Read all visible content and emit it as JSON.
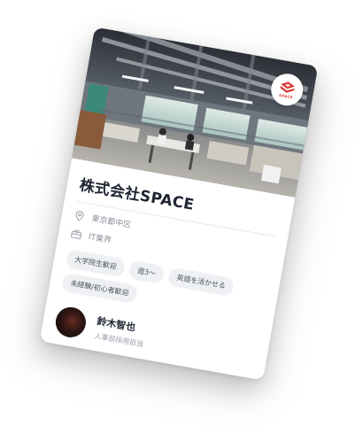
{
  "card": {
    "logo_text": "SPACE",
    "company_name": "株式会社SPACE",
    "location": "東京都中区",
    "industry": "IT業界",
    "tags": [
      "大学院生歓迎",
      "週3〜",
      "英語を活かせる",
      "未経験/初心者歓迎"
    ],
    "person": {
      "name": "鈴木智也",
      "title": "人事部採用担当"
    }
  },
  "colors": {
    "brand": "#d93a35",
    "title": "#1f2532",
    "muted": "#8b909a",
    "tag_bg": "#eef0f3"
  },
  "icons": {
    "location": "map-pin-icon",
    "industry": "briefcase-icon",
    "logo": "space-logo-icon"
  }
}
